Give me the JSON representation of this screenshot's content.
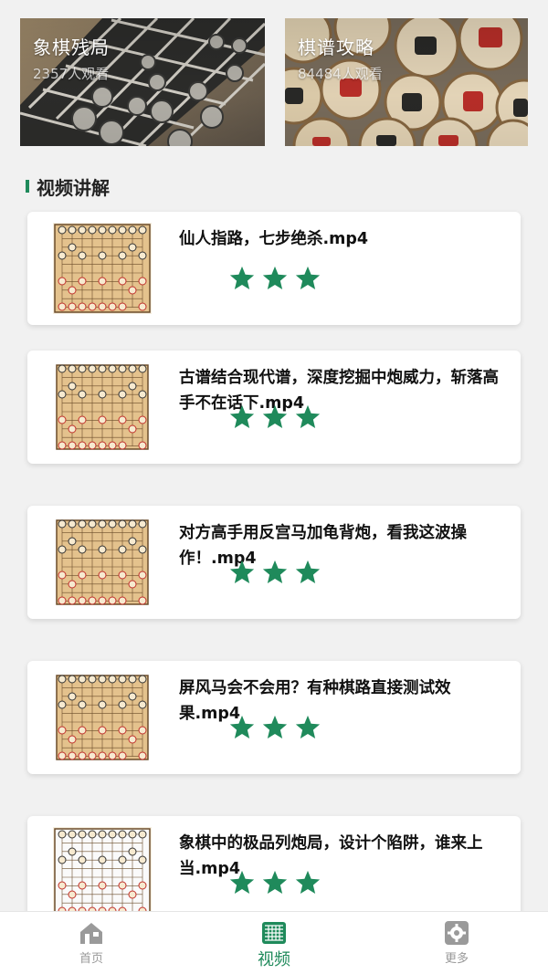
{
  "banners": [
    {
      "title": "象棋残局",
      "subtitle": "2357人观看"
    },
    {
      "title": "棋谱攻略",
      "subtitle": "84484人观看"
    }
  ],
  "section": {
    "title": "视频讲解"
  },
  "videos": [
    {
      "title": "仙人指路，七步绝杀.mp4",
      "stars": 3
    },
    {
      "title": "古谱结合现代谱，深度挖掘中炮威力，斩落高手不在话下.mp4",
      "stars": 3
    },
    {
      "title": "对方高手用反宫马加龟背炮，看我这波操作！.mp4",
      "stars": 3
    },
    {
      "title": "屏风马会不会用？有种棋路直接测试效果.mp4",
      "stars": 3
    },
    {
      "title": "象棋中的极品列炮局，设计个陷阱，谁来上当.mp4",
      "stars": 3
    }
  ],
  "nav": {
    "items": [
      {
        "label": "首页",
        "icon": "home-icon"
      },
      {
        "label": "视频",
        "icon": "chessboard-icon"
      },
      {
        "label": "更多",
        "icon": "gear-icon"
      }
    ],
    "active": 1
  },
  "colors": {
    "accent": "#1f8a5b",
    "star": "#1f8a5b",
    "inactive": "#999999"
  }
}
